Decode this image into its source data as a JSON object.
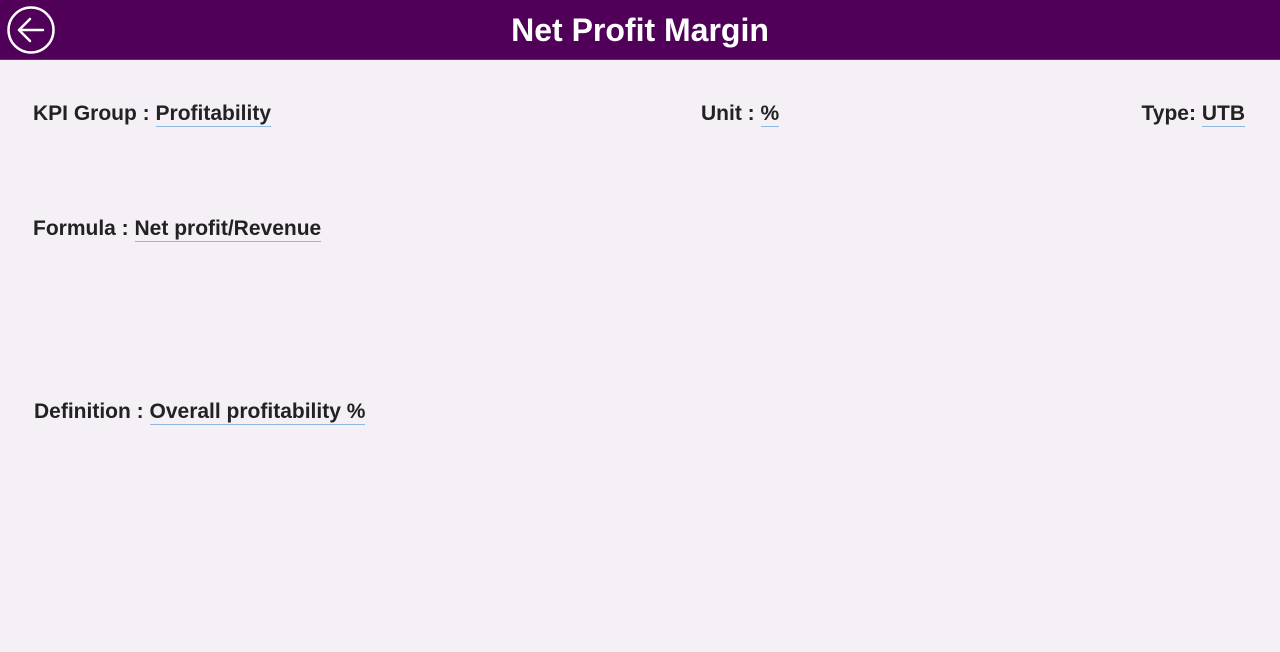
{
  "header": {
    "title": "Net Profit Margin",
    "back_icon": "arrow-left-circle-icon",
    "background_color": "#510059",
    "text_color": "#ffffff"
  },
  "fields": {
    "kpi_group": {
      "label": "KPI Group :",
      "value": "Profitability"
    },
    "unit": {
      "label": "Unit :",
      "value": "%"
    },
    "type": {
      "label": "Type:",
      "value": "UTB"
    },
    "formula": {
      "label": "Formula :",
      "value": "Net profit/Revenue"
    },
    "definition": {
      "label": "Definition :",
      "value": "Overall profitability %"
    }
  },
  "colors": {
    "page_background": "#f4f0f6",
    "underline": "#8fb8e0"
  }
}
